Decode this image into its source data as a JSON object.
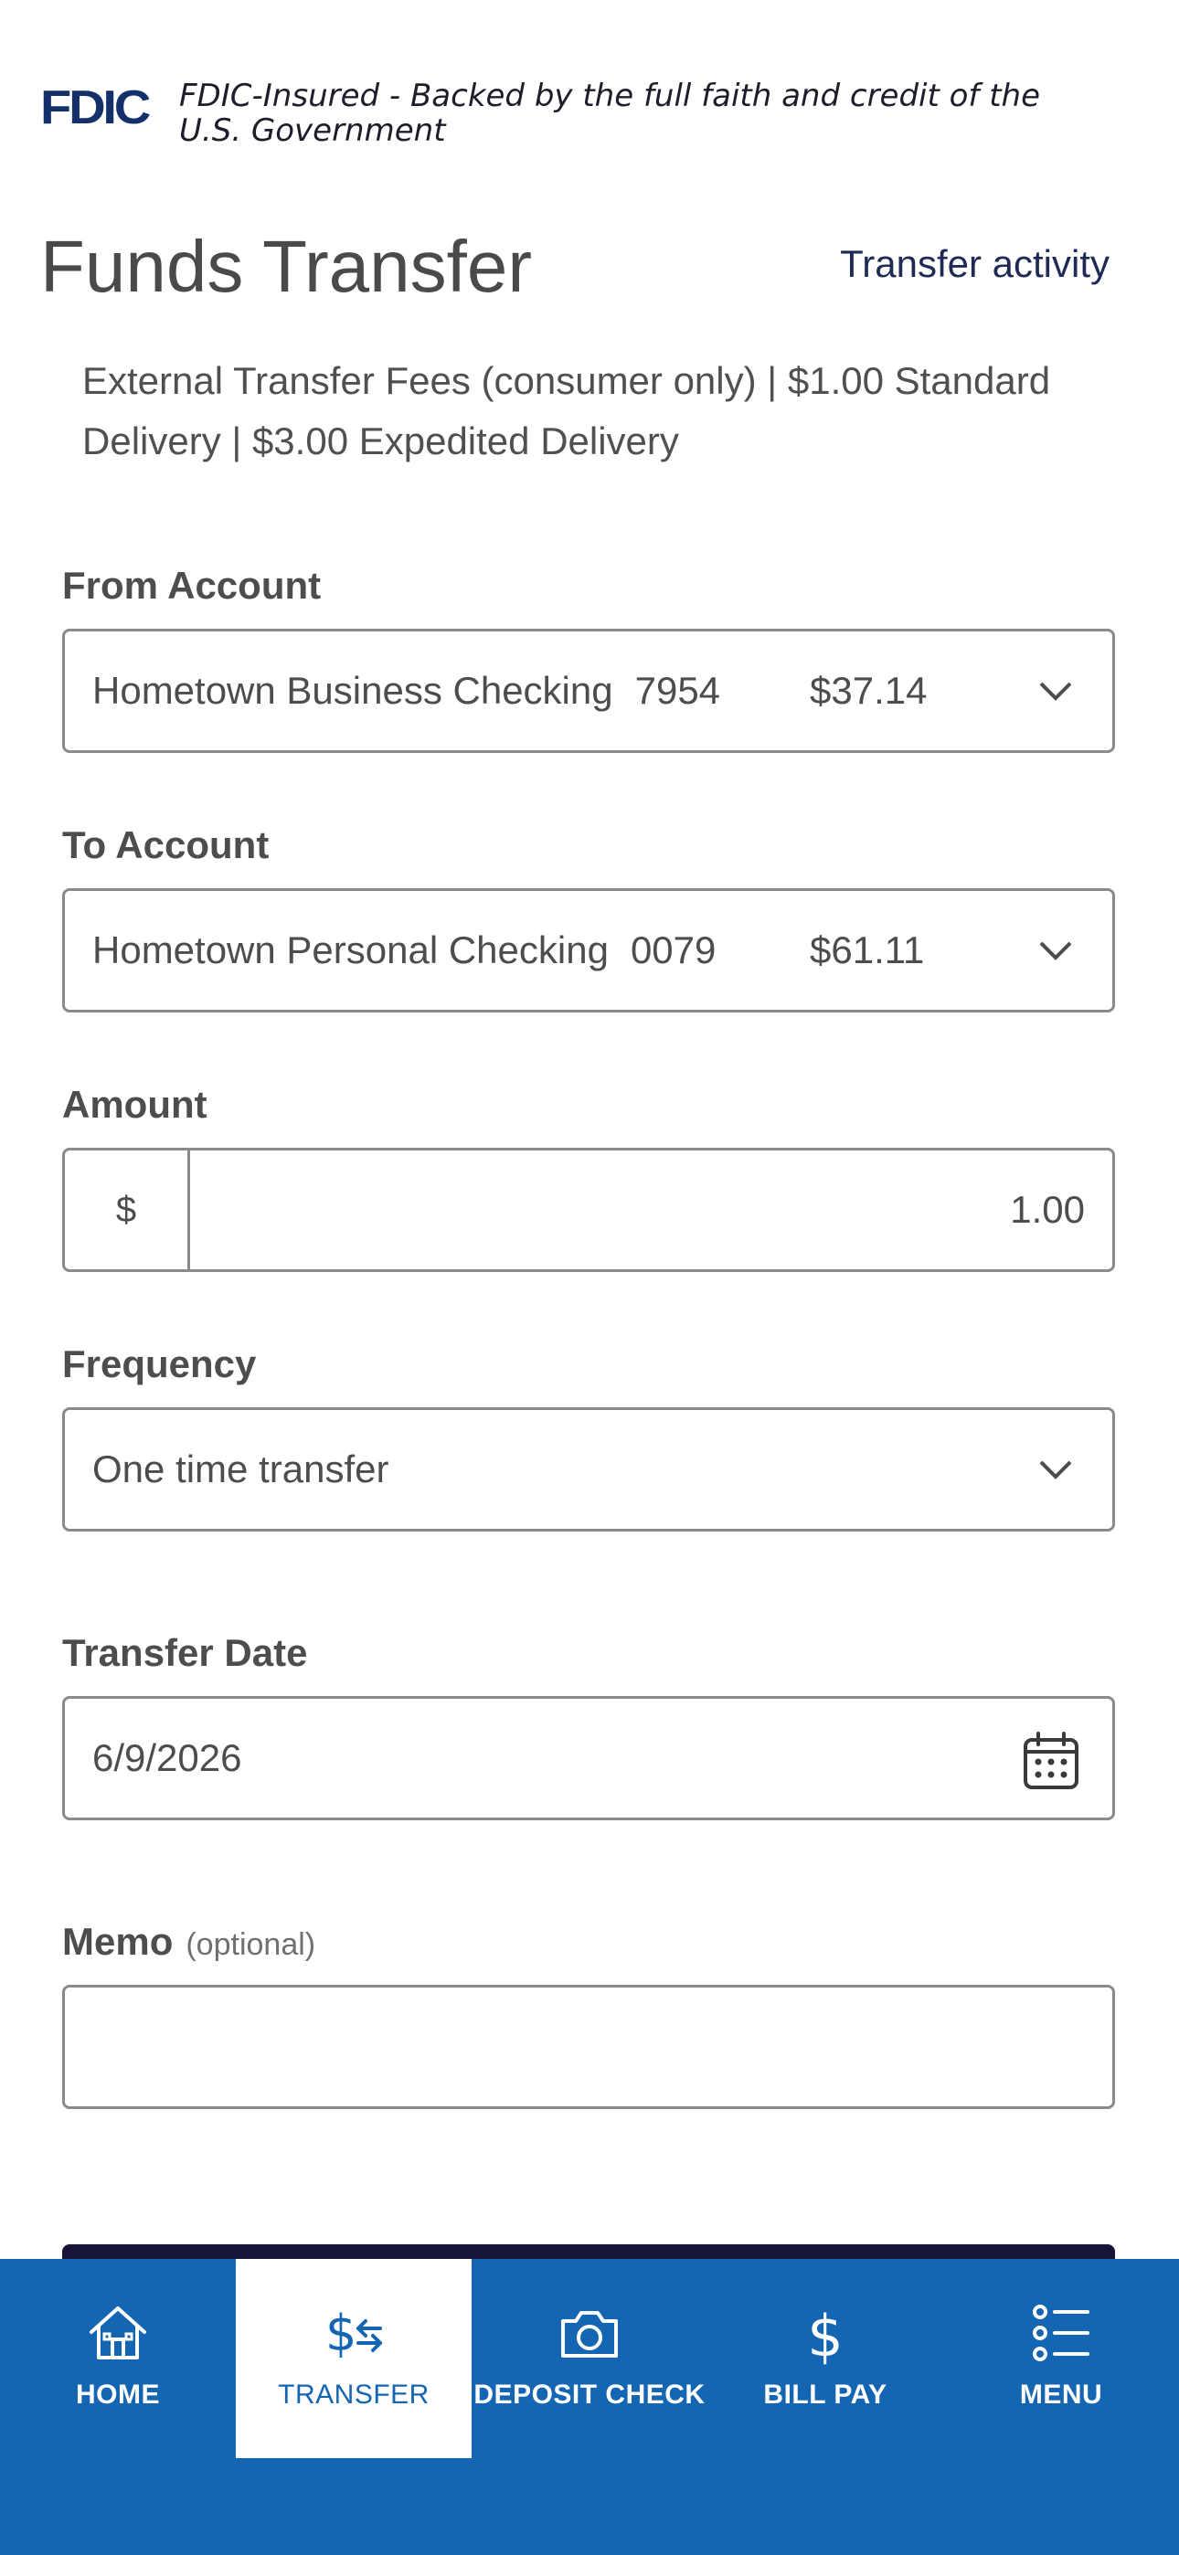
{
  "fdic": {
    "logo": "FDIC",
    "line1": "FDIC-Insured - Backed by the full faith and credit of the",
    "line2": "U.S. Government"
  },
  "header": {
    "title": "Funds Transfer",
    "activity_link": "Transfer activity"
  },
  "fees_note": "External Transfer Fees (consumer only) | $1.00 Standard Delivery | $3.00 Expedited Delivery",
  "from_account": {
    "label": "From Account",
    "name": "Hometown Business Checking",
    "number": "7954",
    "balance": "$37.14"
  },
  "to_account": {
    "label": "To Account",
    "name": "Hometown Personal Checking",
    "number": "0079",
    "balance": "$61.11"
  },
  "amount": {
    "label": "Amount",
    "currency": "$",
    "value": "1.00"
  },
  "frequency": {
    "label": "Frequency",
    "value": "One time transfer"
  },
  "transfer_date": {
    "label": "Transfer Date",
    "value": "6/9/2026"
  },
  "memo": {
    "label": "Memo",
    "optional": "(optional)",
    "value": ""
  },
  "nav": {
    "items": [
      {
        "label": "HOME",
        "icon": "home-icon",
        "active": false
      },
      {
        "label": "TRANSFER",
        "icon": "transfer-icon",
        "active": true
      },
      {
        "label": "DEPOSIT CHECK",
        "icon": "camera-icon",
        "active": false
      },
      {
        "label": "BILL PAY",
        "icon": "dollar-icon",
        "active": false
      },
      {
        "label": "MENU",
        "icon": "menu-list-icon",
        "active": false
      }
    ]
  },
  "colors": {
    "nav_background": "#1466b2",
    "fdic_blue": "#13306b",
    "submit_button": "#17163a"
  }
}
